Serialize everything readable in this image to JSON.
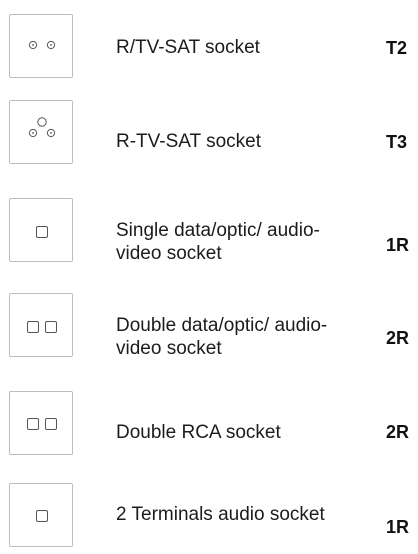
{
  "items": [
    {
      "icon": "r-tv-sat-socket-icon",
      "label": "R/TV-SAT socket",
      "code": "T2"
    },
    {
      "icon": "r-tv-sat-socket-icon",
      "label": "R-TV-SAT socket",
      "code": "T3"
    },
    {
      "icon": "single-square-socket-icon",
      "label": "Single data/optic/ audio-video socket",
      "code": "1R"
    },
    {
      "icon": "double-square-socket-icon",
      "label": "Double data/optic/ audio-video socket",
      "code": "2R"
    },
    {
      "icon": "double-square-socket-icon",
      "label": "Double RCA socket",
      "code": "2R"
    },
    {
      "icon": "single-square-socket-icon",
      "label": "2 Terminals audio socket",
      "code": "1R"
    }
  ]
}
